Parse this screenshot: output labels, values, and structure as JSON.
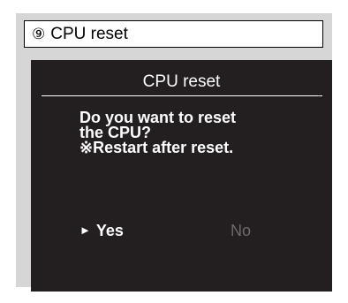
{
  "caption": {
    "number": "⑨",
    "text": "CPU reset"
  },
  "dialog": {
    "title": "CPU reset",
    "message_lines": [
      "Do you want to reset",
      "the CPU?",
      "※Restart after reset."
    ],
    "options": {
      "yes_label": "Yes",
      "no_label": "No",
      "selected": "Yes",
      "cursor_icon": "right-triangle-icon",
      "cursor_glyph": "►"
    }
  },
  "colors": {
    "screen_background": "#231f20",
    "frame_background": "#d6d6d6",
    "text_active": "#ffffff",
    "text_inactive": "#6e6a6b"
  }
}
